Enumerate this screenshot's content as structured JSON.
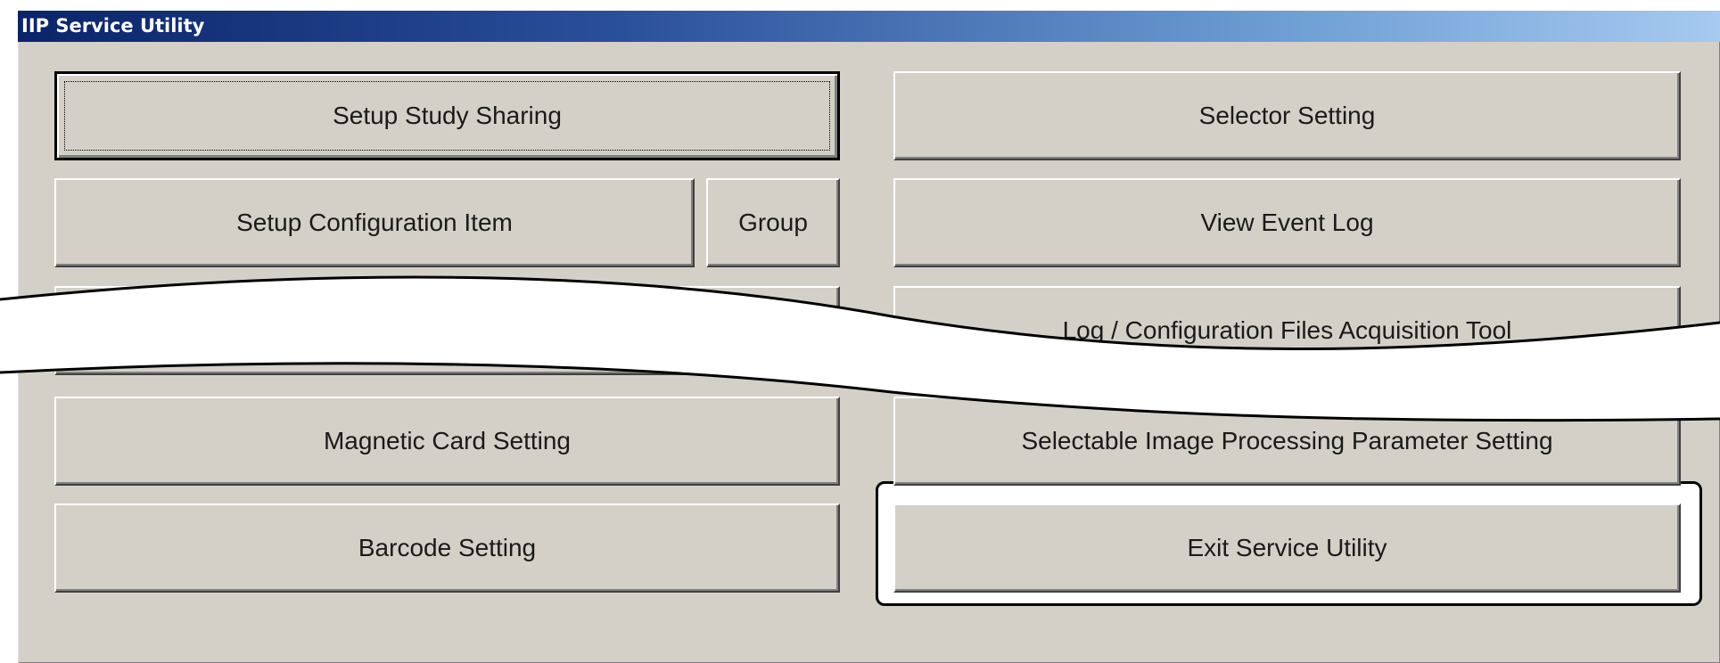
{
  "window": {
    "title": "IIP Service Utility"
  },
  "buttons": {
    "setup_study_sharing": "Setup Study Sharing",
    "setup_configuration_item": "Setup Configuration Item",
    "group": "Group",
    "magnetic_card_setting": "Magnetic Card Setting",
    "barcode_setting": "Barcode Setting",
    "selector_setting": "Selector Setting",
    "view_event_log": "View Event Log",
    "log_configuration_files_acquisition_tool": "Log / Configuration Files Acquisition Tool",
    "selectable_image_processing_parameter_setting": "Selectable Image Processing Parameter Setting",
    "exit_service_utility": "Exit Service Utility"
  }
}
